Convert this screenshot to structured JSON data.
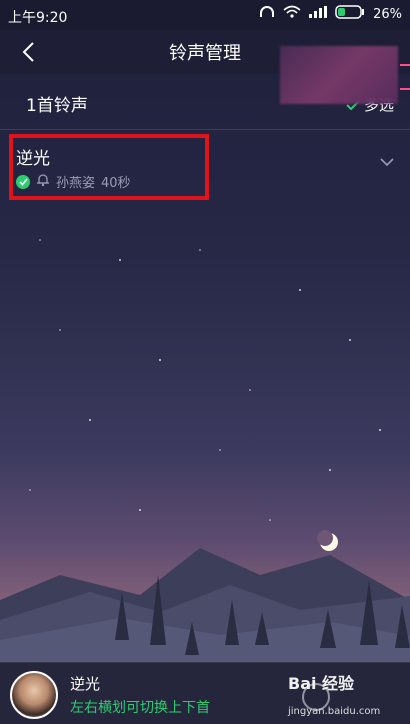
{
  "status": {
    "time": "上午9:20",
    "battery": "26%"
  },
  "header": {
    "title": "铃声管理"
  },
  "toolbar": {
    "count_label": "1首铃声",
    "multi_select_label": "多选"
  },
  "songs": [
    {
      "name": "逆光",
      "artist": "孙燕姿",
      "duration": "40秒"
    }
  ],
  "player": {
    "title": "逆光",
    "hint": "左右横划可切换上下首"
  },
  "watermark": {
    "brand": "Bai 经验",
    "url": "jingyan.baidu.com"
  },
  "colors": {
    "accent": "#2ecc71",
    "highlight": "#e0131b",
    "background": "#1e1f3a"
  },
  "icons": [
    "back-arrow-icon",
    "headphone-icon",
    "wifi-icon",
    "signal-icon",
    "battery-icon",
    "check-icon",
    "bell-icon",
    "chevron-down-icon",
    "moon-icon"
  ]
}
